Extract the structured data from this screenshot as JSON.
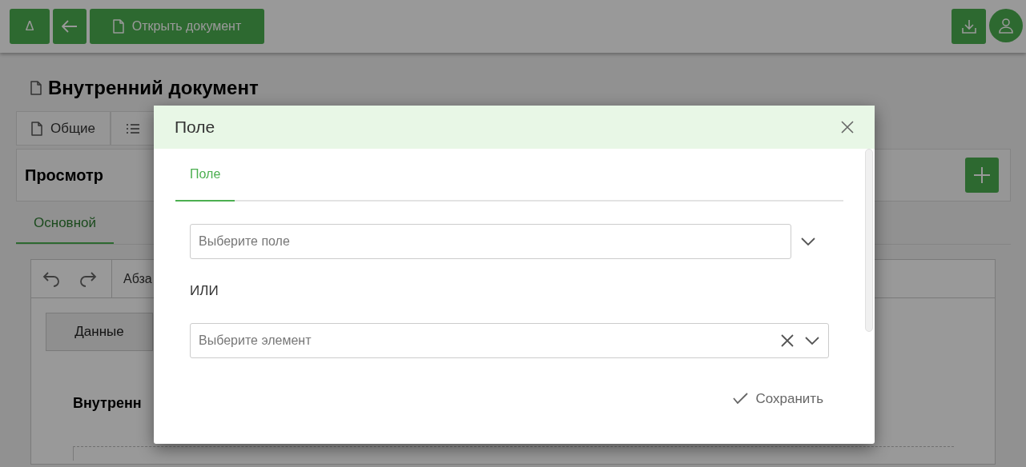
{
  "top_bar": {
    "buttons": [
      {
        "kind": "text",
        "label": "Δ"
      },
      {
        "kind": "back"
      },
      {
        "kind": "open",
        "label": "Открыть документ"
      }
    ]
  },
  "page": {
    "title": "Внутренний документ",
    "tabs": [
      {
        "kind": "labeled",
        "label": "Общие"
      },
      {
        "kind": "icon_only"
      }
    ],
    "section": {
      "title": "Просмотр"
    },
    "section_tabs": [
      {
        "label": "Основной",
        "selected": true
      }
    ],
    "editor": {
      "toolbar_text": "Абза",
      "data_button": "Данные",
      "heading": "Внутренн"
    }
  },
  "dialog": {
    "title": "Поле",
    "tabs": [
      {
        "label": "Поле",
        "selected": true
      }
    ],
    "field_select": {
      "placeholder": "Выберите поле"
    },
    "separator": "ИЛИ",
    "element_select": {
      "placeholder": "Выберите элемент",
      "clearable": true
    },
    "save_button": "Сохранить"
  }
}
